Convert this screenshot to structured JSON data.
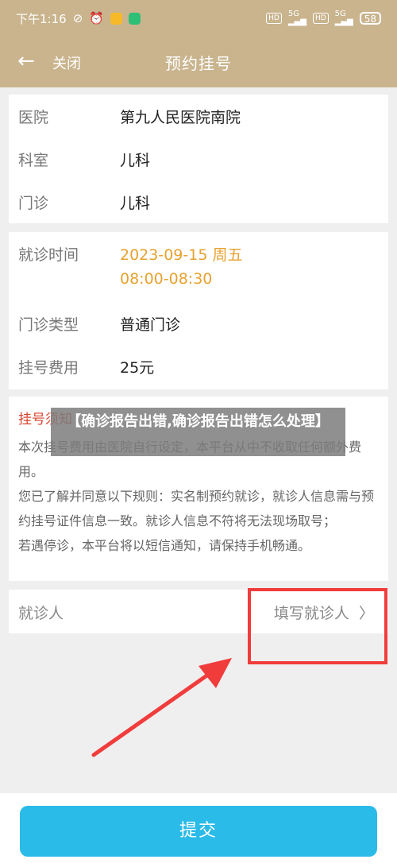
{
  "status": {
    "left_text": "下午1:16",
    "battery": "58",
    "network_a": "5G",
    "network_b": "5G",
    "hd": "HD"
  },
  "nav": {
    "close_label": "关闭",
    "title": "预约挂号"
  },
  "info1": {
    "hospital_label": "医院",
    "hospital_value": "第九人民医院南院",
    "dept_label": "科室",
    "dept_value": "儿科",
    "clinic_label": "门诊",
    "clinic_value": "儿科"
  },
  "info2": {
    "time_label": "就诊时间",
    "time_date": "2023-09-15 周五",
    "time_range": "08:00-08:30",
    "type_label": "门诊类型",
    "type_value": "普通门诊",
    "fee_label": "挂号费用",
    "fee_value": "25元"
  },
  "notice": {
    "title": "挂号须知",
    "lines": [
      "本次挂号费用由医院自行设定，本平台从中不收取任何额外费用。",
      "您已了解并同意以下规则：实名制预约就诊，就诊人信息需与预约挂号证件信息一致。就诊人信息不符将无法现场取号；",
      "若遇停诊，本平台将以短信通知，请保持手机畅通。"
    ]
  },
  "overlay": {
    "text": "【确诊报告出错,确诊报告出错怎么处理】"
  },
  "patient": {
    "label": "就诊人",
    "fill_label": "填写就诊人"
  },
  "submit": {
    "label": "提交"
  },
  "colors": {
    "header": "#c9b48e",
    "orange": "#e7a12f",
    "red": "#f13c3c",
    "submit": "#2bbbe8"
  }
}
